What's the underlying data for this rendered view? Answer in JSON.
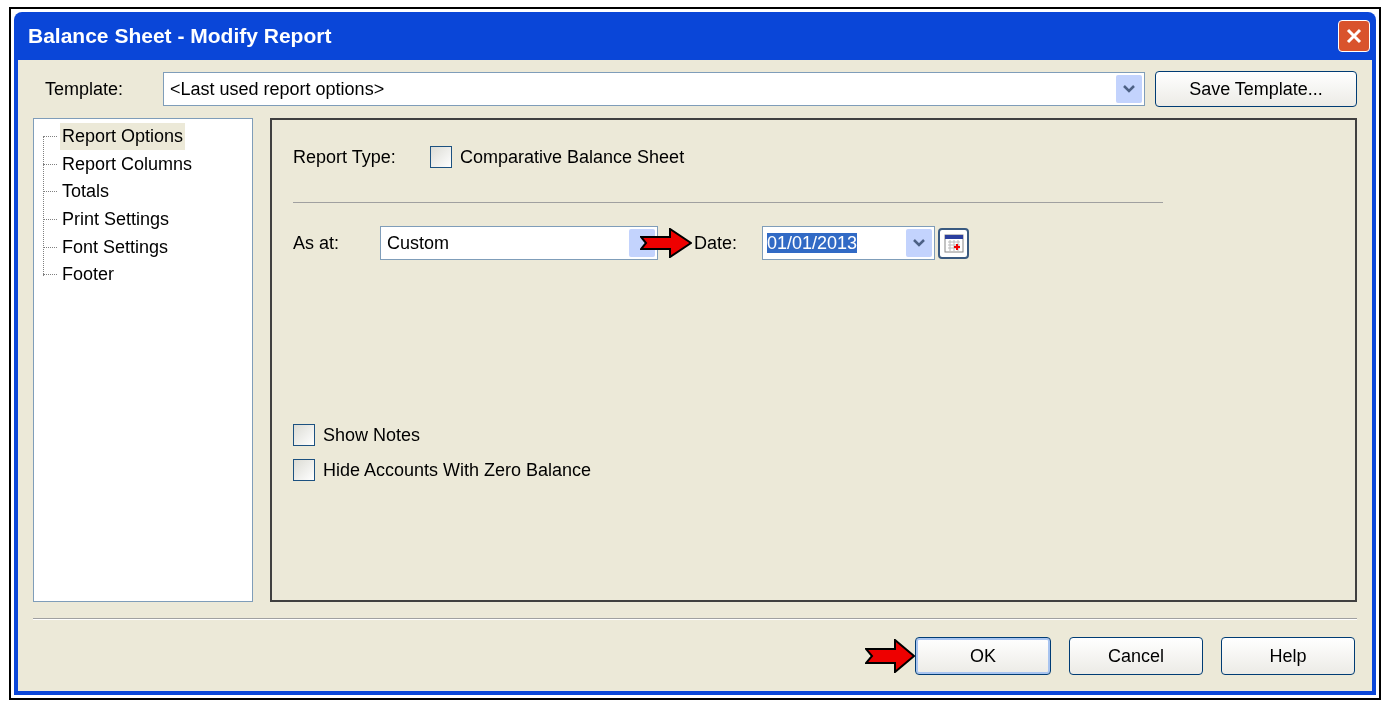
{
  "window": {
    "title": "Balance Sheet - Modify Report"
  },
  "template": {
    "label": "Template:",
    "value": "<Last used report options>"
  },
  "save_template_button": "Save Template...",
  "tree": {
    "items": [
      {
        "label": "Report Options",
        "selected": true
      },
      {
        "label": "Report Columns",
        "selected": false
      },
      {
        "label": "Totals",
        "selected": false
      },
      {
        "label": "Print Settings",
        "selected": false
      },
      {
        "label": "Font Settings",
        "selected": false
      },
      {
        "label": "Footer",
        "selected": false
      }
    ]
  },
  "report_type": {
    "label": "Report Type:",
    "option": {
      "label": "Comparative Balance Sheet",
      "checked": false
    }
  },
  "as_at": {
    "label": "As at:",
    "value": "Custom"
  },
  "date": {
    "label": "Date:",
    "value": "01/01/2013",
    "selected": true
  },
  "options": [
    {
      "label": "Show Notes",
      "checked": false
    },
    {
      "label": "Hide Accounts With Zero Balance",
      "checked": false
    }
  ],
  "buttons": [
    {
      "label": "OK",
      "default": true
    },
    {
      "label": "Cancel",
      "default": false
    },
    {
      "label": "Help",
      "default": false
    }
  ]
}
